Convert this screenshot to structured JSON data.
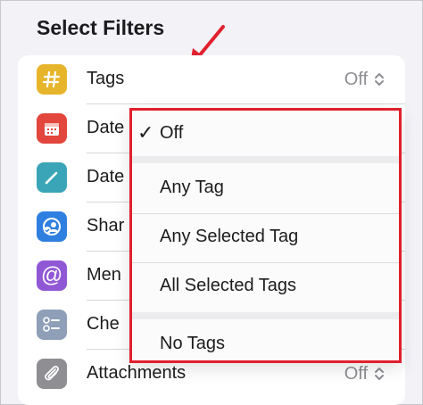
{
  "title": "Select Filters",
  "colors": {
    "highlight": "#e1202e"
  },
  "rows": [
    {
      "label": "Tags",
      "value": "Off",
      "icon": "hashtag-icon",
      "color": "#e7b52c"
    },
    {
      "label": "Date",
      "value": "",
      "icon": "calendar-icon",
      "color": "#e2463c"
    },
    {
      "label": "Date",
      "value": "",
      "icon": "pencil-icon",
      "color": "#3aa5b7"
    },
    {
      "label": "Shar",
      "value": "",
      "icon": "shared-people-icon",
      "color": "#2f7fe0"
    },
    {
      "label": "Men",
      "value": "",
      "icon": "at-sign-icon",
      "color": "#9158d6"
    },
    {
      "label": "Che",
      "value": "",
      "icon": "checklist-icon",
      "color": "#8e9fb7"
    },
    {
      "label": "Attachments",
      "value": "Off",
      "icon": "paperclip-icon",
      "color": "#8e8e93"
    }
  ],
  "menu": {
    "items": [
      "Off",
      "Any Tag",
      "Any Selected Tag",
      "All Selected Tags",
      "No Tags"
    ],
    "selected": "Off",
    "check": "✓"
  }
}
